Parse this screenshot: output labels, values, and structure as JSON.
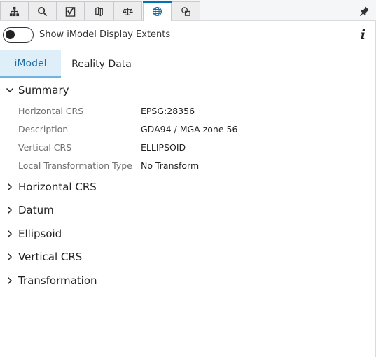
{
  "toolbar": {
    "buttons": [
      {
        "icon": "hierarchy-tree-icon"
      },
      {
        "icon": "search-icon"
      },
      {
        "icon": "clip-check-icon"
      },
      {
        "icon": "map-layers-icon"
      },
      {
        "icon": "balance-scale-icon"
      },
      {
        "icon": "globe-icon",
        "active": true
      },
      {
        "icon": "shapes-icon"
      }
    ],
    "pin_icon": "pin-icon",
    "accent_color": "#0073b5"
  },
  "display_extents": {
    "label": "Show iModel Display Extents",
    "enabled": false,
    "info_glyph": "i"
  },
  "tabs": [
    {
      "label": "iModel",
      "active": true
    },
    {
      "label": "Reality Data",
      "active": false
    }
  ],
  "summary": {
    "title": "Summary",
    "expanded": true,
    "properties": [
      {
        "label": "Horizontal CRS",
        "value": "EPSG:28356"
      },
      {
        "label": "Description",
        "value": "GDA94 / MGA zone 56"
      },
      {
        "label": "Vertical CRS",
        "value": "ELLIPSOID"
      },
      {
        "label": "Local Transformation Type",
        "value": "No Transform"
      }
    ]
  },
  "sections": [
    {
      "title": "Horizontal CRS",
      "expanded": false
    },
    {
      "title": "Datum",
      "expanded": false
    },
    {
      "title": "Ellipsoid",
      "expanded": false
    },
    {
      "title": "Vertical CRS",
      "expanded": false
    },
    {
      "title": "Transformation",
      "expanded": false
    }
  ]
}
